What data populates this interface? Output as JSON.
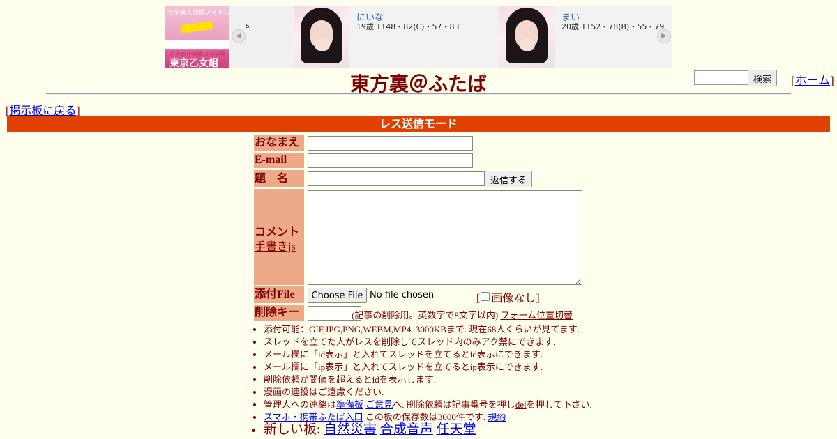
{
  "banner": {
    "ad": {
      "top_text": "完全素人発掘アイドル",
      "sub_text": "ときめき純情ロリ学園",
      "name": "東京乙女組"
    },
    "prev_truncated": "s",
    "cards": [
      {
        "name": "にいな",
        "info": "19歳 T148・82(C)・57・83"
      },
      {
        "name": "まい",
        "info": "20歳 T152・78(B)・55・79"
      }
    ],
    "prev_arrow": "◀",
    "next_arrow": "▶"
  },
  "header": {
    "title": "東方裏＠ふたば",
    "search_button": "検索",
    "home_prefix": "[",
    "home_link": "ホーム",
    "home_suffix": "]"
  },
  "nav": {
    "back_prefix": "[",
    "back_link": "掲示板に戻る",
    "back_suffix": "]"
  },
  "mode_bar": "レス送信モード",
  "form": {
    "name_label": "おなまえ",
    "email_label": "E-mail",
    "subject_label": "題　名",
    "submit_button": "返信する",
    "comment_label": "コメント",
    "comment_js_link": "手書きjs",
    "file_label": "添付File",
    "file_button": "Choose File",
    "file_status": "No file chosen",
    "no_image_open": "[",
    "no_image_label": "画像なし",
    "no_image_close": "]",
    "delkey_label": "削除キー",
    "delkey_note": "(記事の削除用。英数字で8文字以内)",
    "form_toggle_link": "フォーム位置切替"
  },
  "notes": {
    "n1": "添付可能：GIF,JPG,PNG,WEBM,MP4. 3000KBまで. 現在68人くらいが見てます.",
    "n2": "スレッドを立てた人がレスを削除してスレッド内のみアク禁にできます.",
    "n3": "メール欄に「id表示」と入れてスレッドを立てるとid表示にできます.",
    "n4": "メール欄に「ip表示」と入れてスレッドを立てるとip表示にできます.",
    "n5": "削除依頼が閾値を超えるとidを表示します.",
    "n6": "漫画の連投はご遠慮ください.",
    "n7_pre": "管理人への連絡は",
    "n7_link1": "準備板",
    "n7_link2": "ご意見",
    "n7_mid": "へ. 削除依頼は記事番号を押し",
    "n7_del": "del",
    "n7_post": "を押して下さい.",
    "n8_link": "スマホ・携帯ふたば入口",
    "n8_mid": " この板の保存数は3000件です. ",
    "n8_rules": "規約",
    "n9_pre": "新しい板: ",
    "n9_board1": "自然災害",
    "n9_board2": "合成音声",
    "n9_board3": "任天堂"
  }
}
